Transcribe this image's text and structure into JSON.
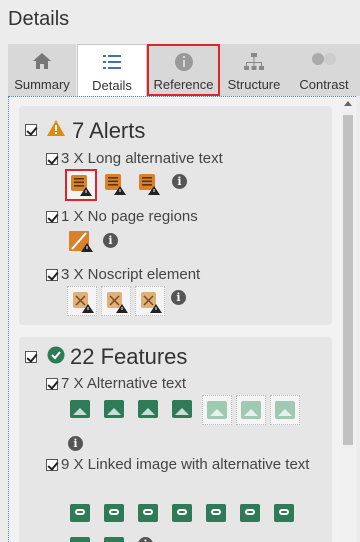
{
  "title": "Details",
  "tabs": [
    {
      "label": "Summary",
      "icon": "home-icon"
    },
    {
      "label": "Details",
      "icon": "list-icon"
    },
    {
      "label": "Reference",
      "icon": "info-icon"
    },
    {
      "label": "Structure",
      "icon": "hierarchy-icon"
    },
    {
      "label": "Contrast",
      "icon": "contrast-icon"
    }
  ],
  "alerts": {
    "heading": "7 Alerts",
    "items": [
      {
        "label": "3 X Long alternative text",
        "icon": "long-alt-text-alert-icon",
        "count": 3
      },
      {
        "label": "1 X No page regions",
        "icon": "no-regions-alert-icon",
        "count": 1
      },
      {
        "label": "3 X Noscript element",
        "icon": "noscript-alert-icon",
        "count": 3
      }
    ]
  },
  "features": {
    "heading": "22 Features",
    "items": [
      {
        "label": "7 X Alternative text",
        "icon": "alt-text-feature-icon",
        "count": 7
      },
      {
        "label": "9 X Linked image with alternative text",
        "icon": "linked-image-feature-icon",
        "count": 9
      }
    ]
  },
  "info_glyph": "i",
  "colors": {
    "alert": "#e08a12",
    "feature": "#2f7b58",
    "highlight": "#d9262b"
  }
}
